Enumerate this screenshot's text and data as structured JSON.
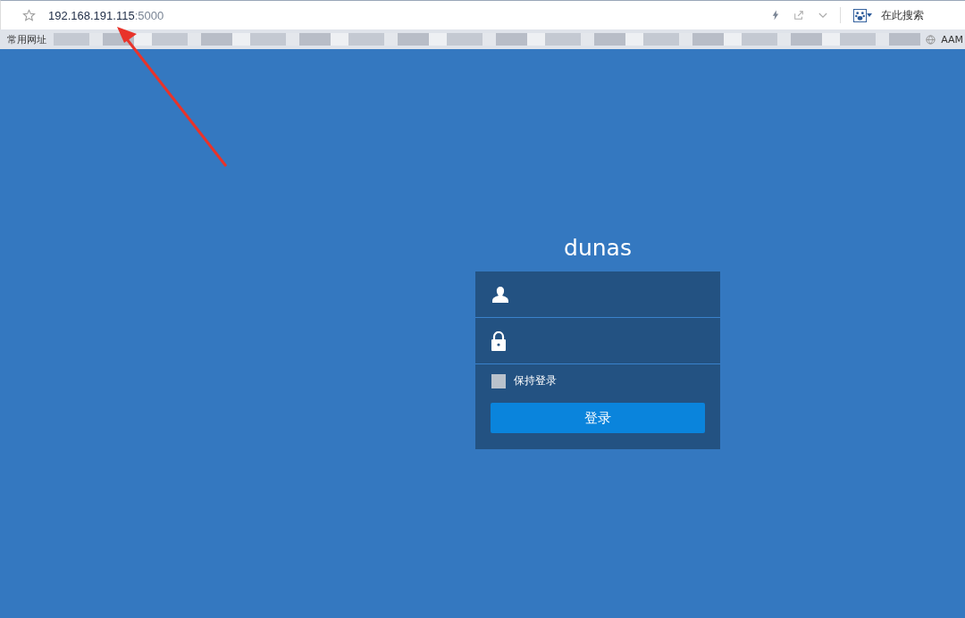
{
  "browser": {
    "address_host": "192.168.191.115",
    "address_port": ":5000",
    "search_placeholder": "在此搜索",
    "bookmarks": [
      "常用网址",
      "AAM"
    ]
  },
  "login": {
    "title": "dunas",
    "remember": {
      "label": "保持登录",
      "checked": false
    },
    "submit": "登录"
  }
}
